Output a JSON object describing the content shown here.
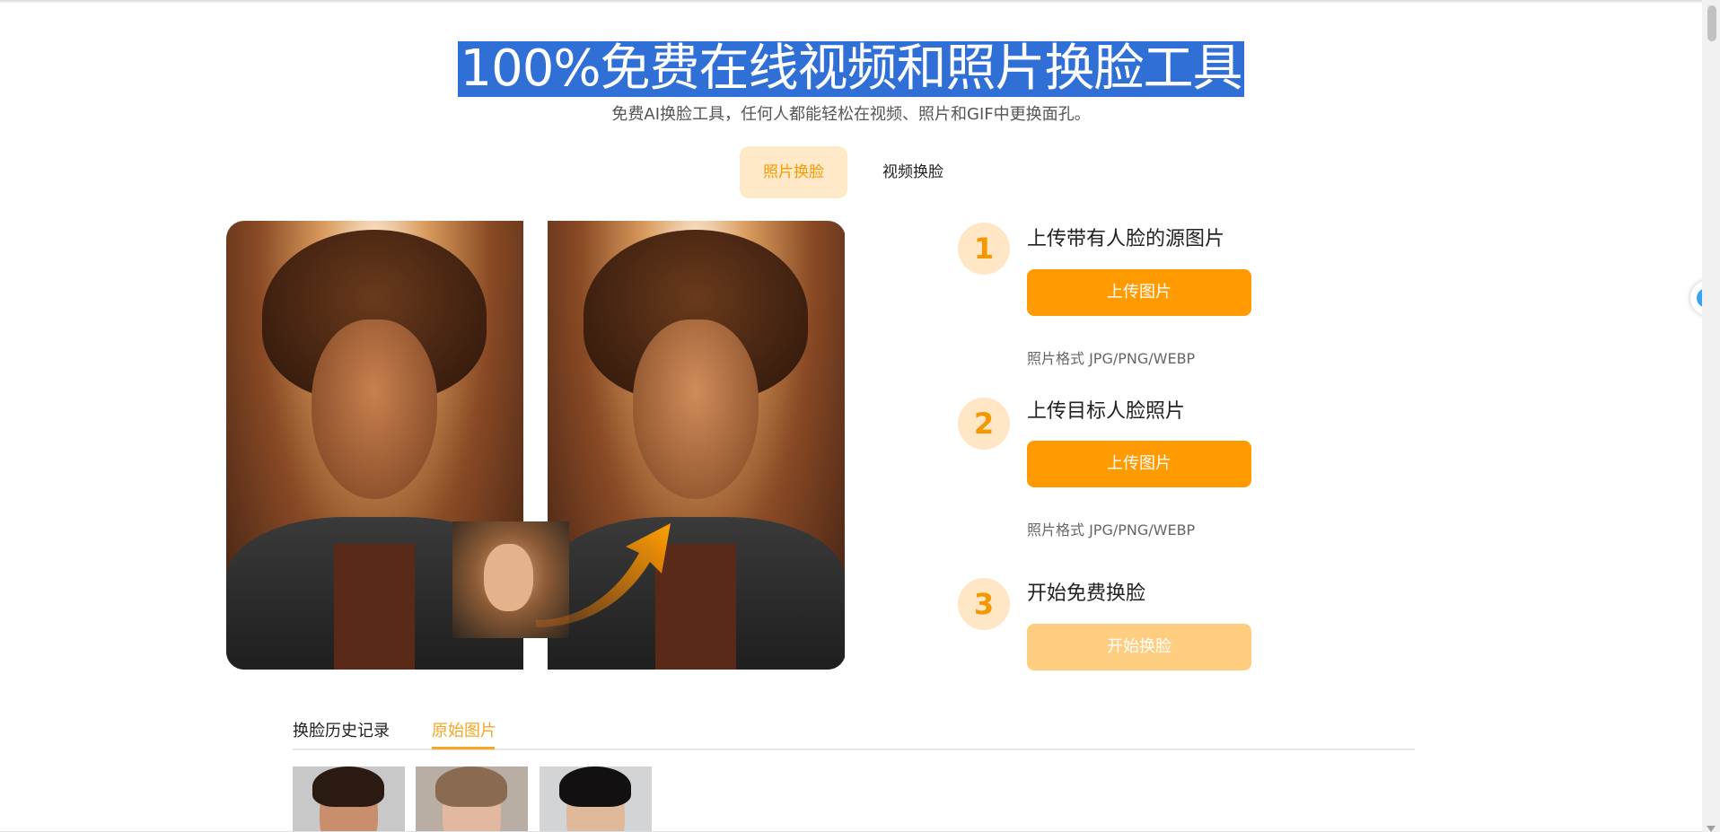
{
  "header": {
    "title": "100%免费在线视频和照片换脸工具",
    "subtitle": "免费AI换脸工具，任何人都能轻松在视频、照片和GIF中更换面孔。"
  },
  "mode_tabs": [
    {
      "label": "照片换脸",
      "active": true
    },
    {
      "label": "视频换脸",
      "active": false
    }
  ],
  "steps": [
    {
      "number": "1",
      "title": "上传带有人脸的源图片",
      "button": "上传图片",
      "hint": "照片格式 JPG/PNG/WEBP"
    },
    {
      "number": "2",
      "title": "上传目标人脸照片",
      "button": "上传图片",
      "hint": "照片格式 JPG/PNG/WEBP"
    },
    {
      "number": "3",
      "title": "开始免费换脸",
      "button": "开始换脸"
    }
  ],
  "history": {
    "tabs": [
      {
        "label": "换脸历史记录",
        "active": false
      },
      {
        "label": "原始图片",
        "active": true
      }
    ]
  },
  "colors": {
    "accent": "#ff9a00",
    "accent_light": "#ffe6c4",
    "selection": "#2f6fd6",
    "disabled_button": "#ffcd80"
  },
  "icons": {
    "side_widget": "chevron-left-icon",
    "swap_arrow": "curved-arrow-icon"
  }
}
